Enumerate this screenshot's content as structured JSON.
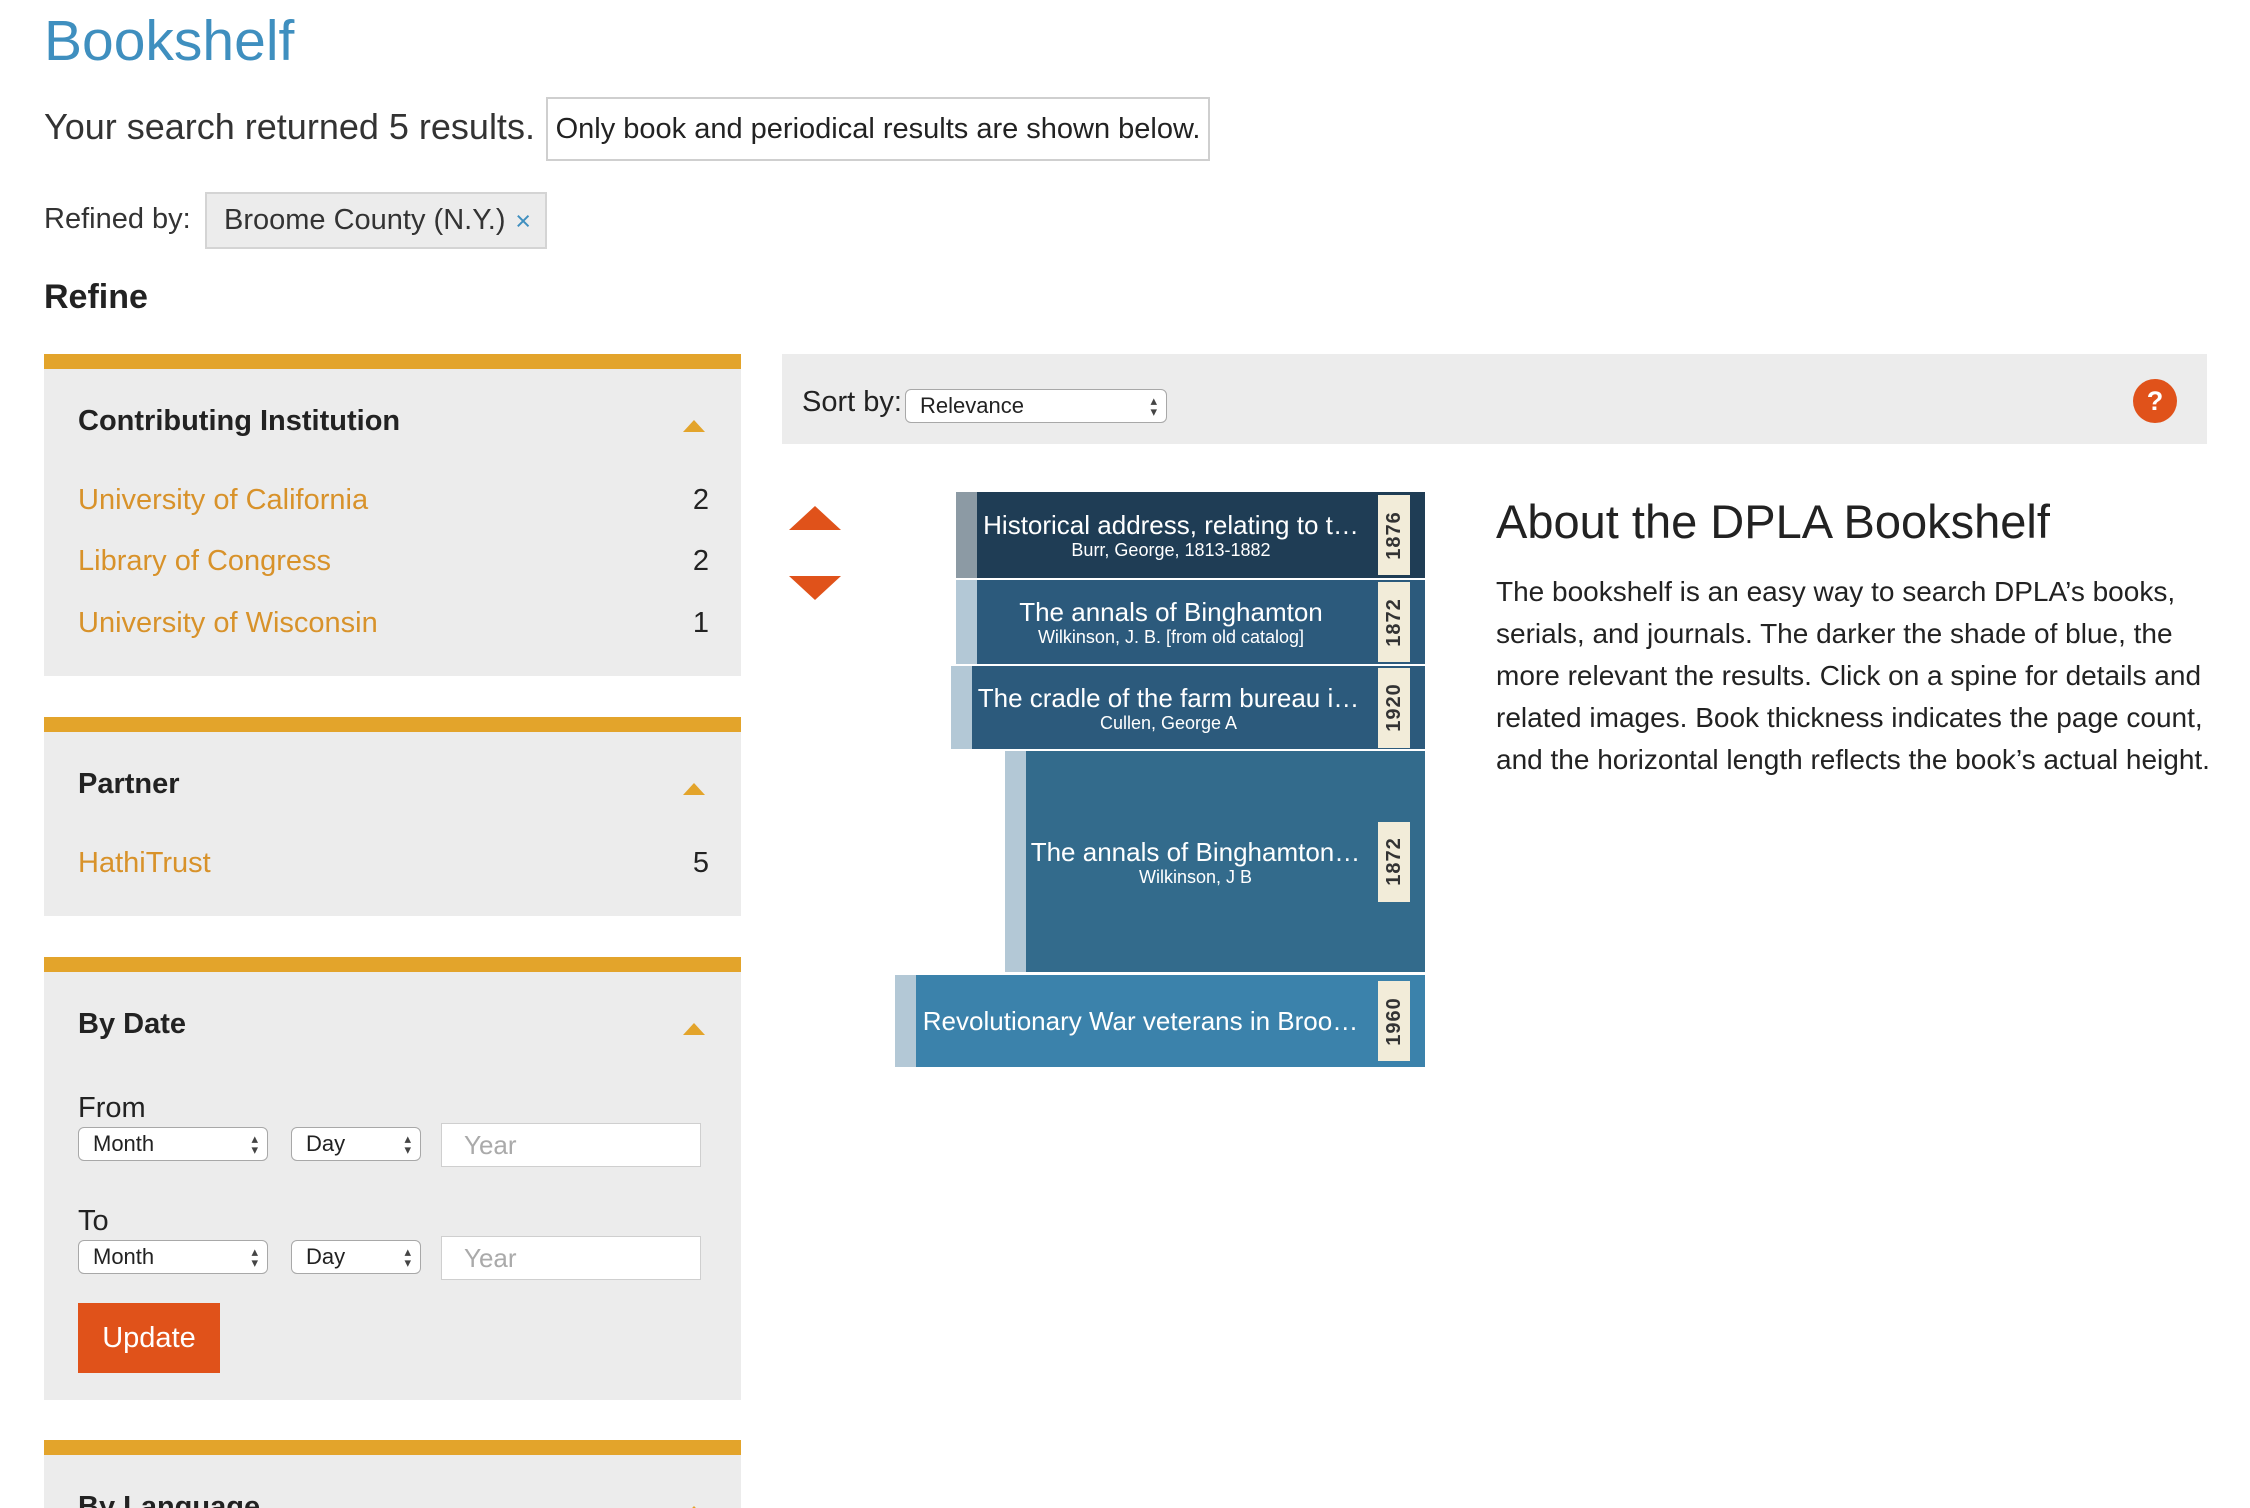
{
  "page": {
    "title": "Bookshelf"
  },
  "search": {
    "results_text": "Your search returned 5 results.",
    "notice": "Only book and periodical results are shown below."
  },
  "refined": {
    "label": "Refined by:",
    "chips": [
      {
        "label": "Broome County (N.Y.)",
        "remove_icon": "×"
      }
    ]
  },
  "refine": {
    "heading": "Refine",
    "facets": {
      "institution": {
        "title": "Contributing Institution",
        "items": [
          {
            "label": "University of California",
            "count": "2"
          },
          {
            "label": "Library of Congress",
            "count": "2"
          },
          {
            "label": "University of Wisconsin",
            "count": "1"
          }
        ]
      },
      "partner": {
        "title": "Partner",
        "items": [
          {
            "label": "HathiTrust",
            "count": "5"
          }
        ]
      },
      "date": {
        "title": "By Date",
        "from_label": "From",
        "to_label": "To",
        "month_label": "Month",
        "day_label": "Day",
        "year_placeholder": "Year",
        "update_label": "Update"
      },
      "language": {
        "title": "By Language"
      }
    }
  },
  "sort": {
    "label": "Sort by:",
    "selected": "Relevance",
    "help_icon": "?"
  },
  "shelf": {
    "books": [
      {
        "title": "Historical address, relating to t…",
        "author": "Burr, George, 1813-1882",
        "year": "1876",
        "color": "#1f3d55",
        "edge_color": "#8c9aa4"
      },
      {
        "title": "The annals of Binghamton",
        "author": "Wilkinson, J. B. [from old catalog]",
        "year": "1872",
        "color": "#2c5a7c",
        "edge_color": "#b3c8d6"
      },
      {
        "title": "The cradle of the farm bureau i…",
        "author": "Cullen, George A",
        "year": "1920",
        "color": "#2c5a7c",
        "edge_color": "#b3c8d6"
      },
      {
        "title": "The annals of Binghamton…",
        "author": "Wilkinson, J B",
        "year": "1872",
        "color": "#336b8c",
        "edge_color": "#b3c8d6"
      },
      {
        "title": "Revolutionary War veterans in Broo…",
        "author": "",
        "year": "1960",
        "color": "#3b82ab",
        "edge_color": "#b3c8d6"
      }
    ]
  },
  "about": {
    "title": "About the DPLA Bookshelf",
    "text": "The bookshelf is an easy way to search DPLA’s books, serials, and journals. The darker the shade of blue, the more relevant the results. Click on a spine for details and related images. Book thickness indicates the page count, and the horizontal length reflects the book’s actual height."
  },
  "colors": {
    "accent_blue": "#3f8fbf",
    "facet_gold": "#e3a42b",
    "action_orange": "#e0521a"
  }
}
